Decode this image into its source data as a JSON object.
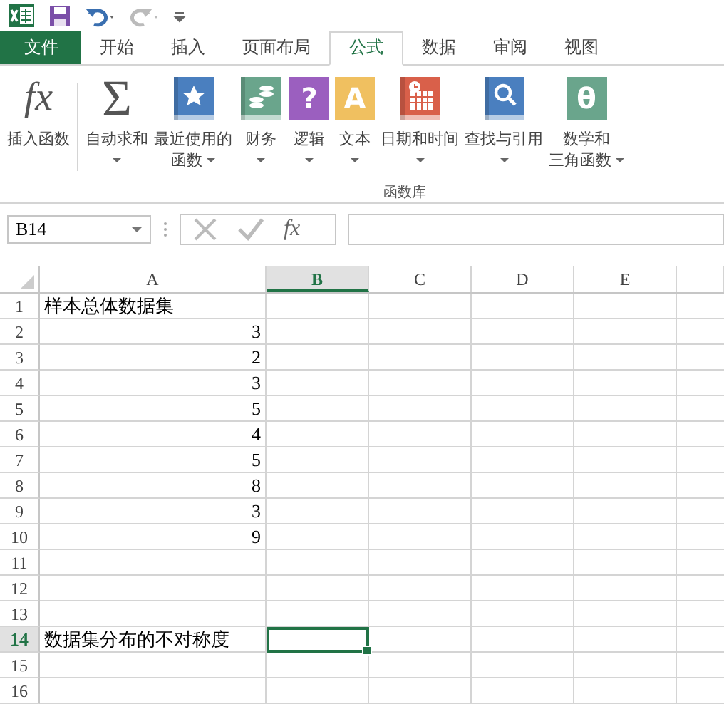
{
  "quick_access": {
    "undo_enabled": true,
    "redo_enabled": false
  },
  "tabs": [
    {
      "label": "文件",
      "kind": "file",
      "selected": false
    },
    {
      "label": "开始",
      "kind": "tab",
      "selected": false
    },
    {
      "label": "插入",
      "kind": "tab",
      "selected": false
    },
    {
      "label": "页面布局",
      "kind": "tab",
      "selected": false
    },
    {
      "label": "公式",
      "kind": "tab",
      "selected": true
    },
    {
      "label": "数据",
      "kind": "tab",
      "selected": false
    },
    {
      "label": "审阅",
      "kind": "tab",
      "selected": false
    },
    {
      "label": "视图",
      "kind": "tab",
      "selected": false
    }
  ],
  "ribbon": {
    "group_label": "函数库",
    "buttons": [
      {
        "kind": "glyph",
        "glyph": "fx",
        "label": "插入函数",
        "dropdown": false
      },
      {
        "kind": "glyph",
        "glyph": "Σ",
        "label": "自动求和",
        "dropdown": true
      },
      {
        "kind": "book-star",
        "color": "#4a7fbf",
        "label": "最近使用的",
        "label2": "函数",
        "dropdown": true
      },
      {
        "kind": "book-coins",
        "color": "#6aa58c",
        "label": "财务",
        "dropdown": true
      },
      {
        "kind": "book-glyph",
        "glyph": "?",
        "color": "#9b5fbf",
        "label": "逻辑",
        "dropdown": true
      },
      {
        "kind": "book-glyph",
        "glyph": "A",
        "color": "#f0c060",
        "label": "文本",
        "dropdown": true
      },
      {
        "kind": "book-calendar",
        "color": "#d9604a",
        "label": "日期和时间",
        "dropdown": true
      },
      {
        "kind": "book-search",
        "color": "#4a7fbf",
        "label": "查找与引用",
        "dropdown": true
      },
      {
        "kind": "book-glyph",
        "glyph": "θ",
        "color": "#6aa58c",
        "label": "数学和",
        "label2": "三角函数",
        "dropdown": true
      }
    ]
  },
  "formula_bar": {
    "name_box": "B14",
    "fx": "fx",
    "value_enabled": false
  },
  "sheet": {
    "columns": [
      {
        "label": "A",
        "selected": false
      },
      {
        "label": "B",
        "selected": true
      },
      {
        "label": "C",
        "selected": false
      },
      {
        "label": "D",
        "selected": false
      },
      {
        "label": "E",
        "selected": false
      }
    ],
    "rows": [
      {
        "number": "1",
        "selected": false,
        "cells": [
          {
            "value": "样本总体数据集",
            "kind": "text"
          }
        ]
      },
      {
        "number": "2",
        "selected": false,
        "cells": [
          {
            "value": "3",
            "kind": "number"
          }
        ]
      },
      {
        "number": "3",
        "selected": false,
        "cells": [
          {
            "value": "2",
            "kind": "number"
          }
        ]
      },
      {
        "number": "4",
        "selected": false,
        "cells": [
          {
            "value": "3",
            "kind": "number"
          }
        ]
      },
      {
        "number": "5",
        "selected": false,
        "cells": [
          {
            "value": "5",
            "kind": "number"
          }
        ]
      },
      {
        "number": "6",
        "selected": false,
        "cells": [
          {
            "value": "4",
            "kind": "number"
          }
        ]
      },
      {
        "number": "7",
        "selected": false,
        "cells": [
          {
            "value": "5",
            "kind": "number"
          }
        ]
      },
      {
        "number": "8",
        "selected": false,
        "cells": [
          {
            "value": "8",
            "kind": "number"
          }
        ]
      },
      {
        "number": "9",
        "selected": false,
        "cells": [
          {
            "value": "3",
            "kind": "number"
          }
        ]
      },
      {
        "number": "10",
        "selected": false,
        "cells": [
          {
            "value": "9",
            "kind": "number"
          }
        ]
      },
      {
        "number": "11",
        "selected": false,
        "cells": []
      },
      {
        "number": "12",
        "selected": false,
        "cells": []
      },
      {
        "number": "13",
        "selected": false,
        "cells": []
      },
      {
        "number": "14",
        "selected": true,
        "cells": [
          {
            "value": "数据集分布的不对称度",
            "kind": "text"
          }
        ]
      },
      {
        "number": "15",
        "selected": false,
        "cells": []
      },
      {
        "number": "16",
        "selected": false,
        "cells": []
      }
    ]
  }
}
